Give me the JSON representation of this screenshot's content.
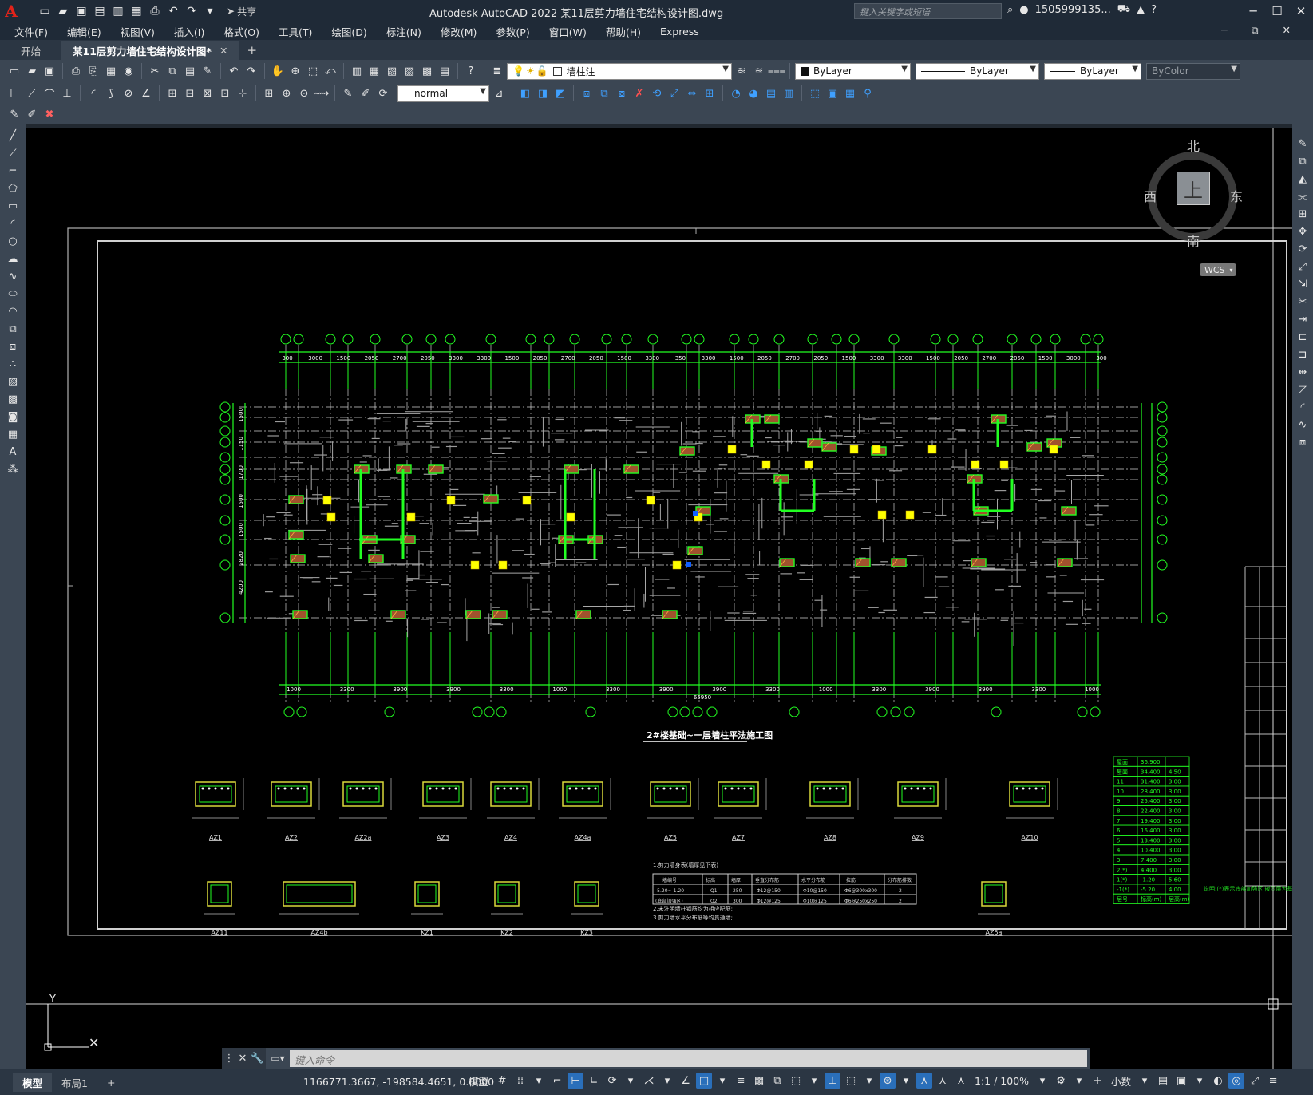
{
  "app": {
    "logo": "A",
    "title": "Autodesk AutoCAD 2022    某11层剪力墙住宅结构设计图.dwg",
    "share_label": "共享",
    "search_placeholder": "键入关键字或短语",
    "user": "1505999135...",
    "brand_color": "#e2231a"
  },
  "menu": {
    "items": [
      "文件(F)",
      "编辑(E)",
      "视图(V)",
      "插入(I)",
      "格式(O)",
      "工具(T)",
      "绘图(D)",
      "标注(N)",
      "修改(M)",
      "参数(P)",
      "窗口(W)",
      "帮助(H)",
      "Express"
    ]
  },
  "tabs": {
    "start": "开始",
    "active": "某11层剪力墙住宅结构设计图*",
    "close": "✕",
    "add": "+"
  },
  "toolbar": {
    "layer": "墙柱注",
    "color": "ByLayer",
    "linetype": "ByLayer",
    "lineweight": "ByLayer",
    "plotstyle": "ByColor",
    "dimstyle": "normal"
  },
  "viewcube": {
    "north": "北",
    "south": "南",
    "west": "西",
    "east": "东",
    "top": "上",
    "wcs": "WCS"
  },
  "drawing": {
    "plan_title": "2#楼基础~一层墙柱平法施工图",
    "detail_labels_row1": [
      "AZ1",
      "AZ2",
      "AZ2a",
      "AZ3",
      "AZ4",
      "AZ4a",
      "AZ5",
      "AZ7",
      "AZ8",
      "AZ9",
      "AZ10"
    ],
    "detail_labels_row2": [
      "AZ11",
      "AZ4b",
      "KZ1",
      "KZ2",
      "KZ3",
      "AZ5a"
    ],
    "top_dims": [
      "300",
      "3000",
      "1500",
      "2050",
      "2700",
      "2050",
      "3300",
      "3300",
      "1500",
      "2050",
      "2700",
      "2050",
      "1500",
      "3300",
      "350",
      "3300",
      "1500",
      "2050",
      "2700",
      "2050",
      "1500",
      "3300",
      "3300",
      "1500",
      "2050",
      "2700",
      "2050",
      "1500",
      "3000",
      "300"
    ],
    "bottom_dims": [
      "1000",
      "3300",
      "3900",
      "3900",
      "3300",
      "1000",
      "3300",
      "3900",
      "3900",
      "3300",
      "1000",
      "3300",
      "3900",
      "3900",
      "3300",
      "1000"
    ],
    "bottom_total": "65950",
    "left_dims": [
      "1500",
      "1150",
      "1700",
      "1500",
      "1500",
      "2820",
      "4200"
    ],
    "elev_table": {
      "rows": [
        [
          "屋面",
          "36.900",
          ""
        ],
        [
          "屋面",
          "34.400",
          "4.50"
        ],
        [
          "11",
          "31.400",
          "3.00"
        ],
        [
          "10",
          "28.400",
          "3.00"
        ],
        [
          "9",
          "25.400",
          "3.00"
        ],
        [
          "8",
          "22.400",
          "3.00"
        ],
        [
          "7",
          "19.400",
          "3.00"
        ],
        [
          "6",
          "16.400",
          "3.00"
        ],
        [
          "5",
          "13.400",
          "3.00"
        ],
        [
          "4",
          "10.400",
          "3.00"
        ],
        [
          "3",
          "7.400",
          "3.00"
        ],
        [
          "2(*)",
          "4.400",
          "3.00"
        ],
        [
          "1(*)",
          "-1.20",
          "5.60"
        ],
        [
          "-1(*)",
          "-5.20",
          "4.00"
        ],
        [
          "层号",
          "标高(m)",
          "层高(m)"
        ]
      ]
    },
    "notes": [
      "1.剪力墙身表(墙厚见下表)",
      "2.未注明墙柱钢筋均为相应配筋;",
      "3.剪力墙水平分布筋等均贯通墙;"
    ],
    "wall_table": {
      "header": [
        "墙编号",
        "标高",
        "墙厚",
        "垂直分布筋",
        "水平分布筋",
        "拉筋",
        "分布筋排数"
      ],
      "rows": [
        [
          "-5.20~-1.20",
          "Q1",
          "250",
          "Φ12@150",
          "Φ10@150",
          "Φ6@300x300",
          "2"
        ],
        [
          "(底部加强区)",
          "Q2",
          "300",
          "Φ12@125",
          "Φ10@125",
          "Φ6@250x250",
          "2"
        ]
      ]
    },
    "table_note": "说明:(*)表示底部加强区 嵌固层为基础顶面"
  },
  "command": {
    "placeholder": "键入命令"
  },
  "status": {
    "model_tab": "模型",
    "layout_tab": "布局1",
    "add": "+",
    "coords": "1166771.3667, -198584.4651, 0.0000",
    "model": "模型",
    "scale": "1:1 / 100%",
    "units": "小数"
  }
}
